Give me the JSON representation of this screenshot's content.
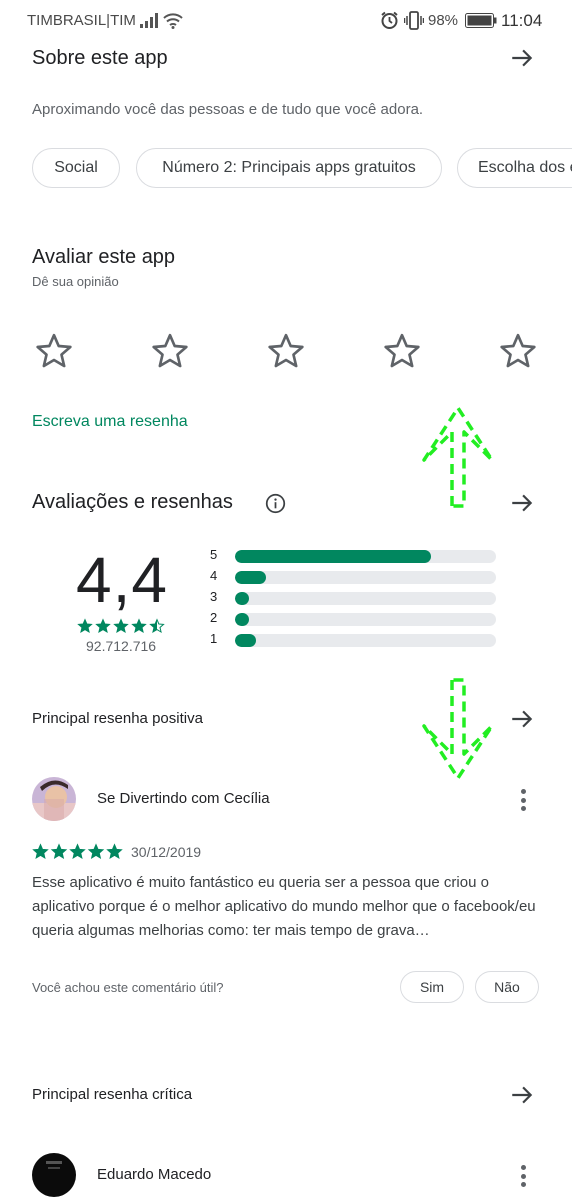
{
  "status_bar": {
    "carrier": "TIMBRASIL|TIM",
    "battery": "98%",
    "time": "11:04"
  },
  "about": {
    "title": "Sobre este app",
    "description": "Aproximando você das pessoas e de tudo que você adora.",
    "chips": [
      "Social",
      "Número 2: Principais apps gratuitos",
      "Escolha dos e"
    ]
  },
  "rate": {
    "title": "Avaliar este app",
    "subtitle": "Dê sua opinião",
    "write_review": "Escreva uma resenha"
  },
  "ratings": {
    "title": "Avaliações e resenhas",
    "average": "4,4",
    "average_stars": 4.5,
    "count": "92.712.716",
    "distribution": [
      {
        "label": "5",
        "fraction": 0.75
      },
      {
        "label": "4",
        "fraction": 0.12
      },
      {
        "label": "3",
        "fraction": 0.055
      },
      {
        "label": "2",
        "fraction": 0.055
      },
      {
        "label": "1",
        "fraction": 0.08
      }
    ]
  },
  "positive_review": {
    "section_title": "Principal resenha positiva",
    "author": "Se Divertindo com Cecília",
    "stars": 5,
    "date": "30/12/2019",
    "text": "Esse aplicativo é muito fantástico eu queria ser a pessoa que criou o aplicativo porque é o melhor aplicativo do mundo melhor que o facebook/eu queria algumas melhorias como: ter mais tempo de grava…",
    "helpful_prompt": "Você achou este comentário útil?",
    "yes_label": "Sim",
    "no_label": "Não"
  },
  "critical_review": {
    "section_title": "Principal resenha crítica",
    "author": "Eduardo Macedo"
  },
  "colors": {
    "accent": "#01875f",
    "annotation": "#22ee22"
  }
}
